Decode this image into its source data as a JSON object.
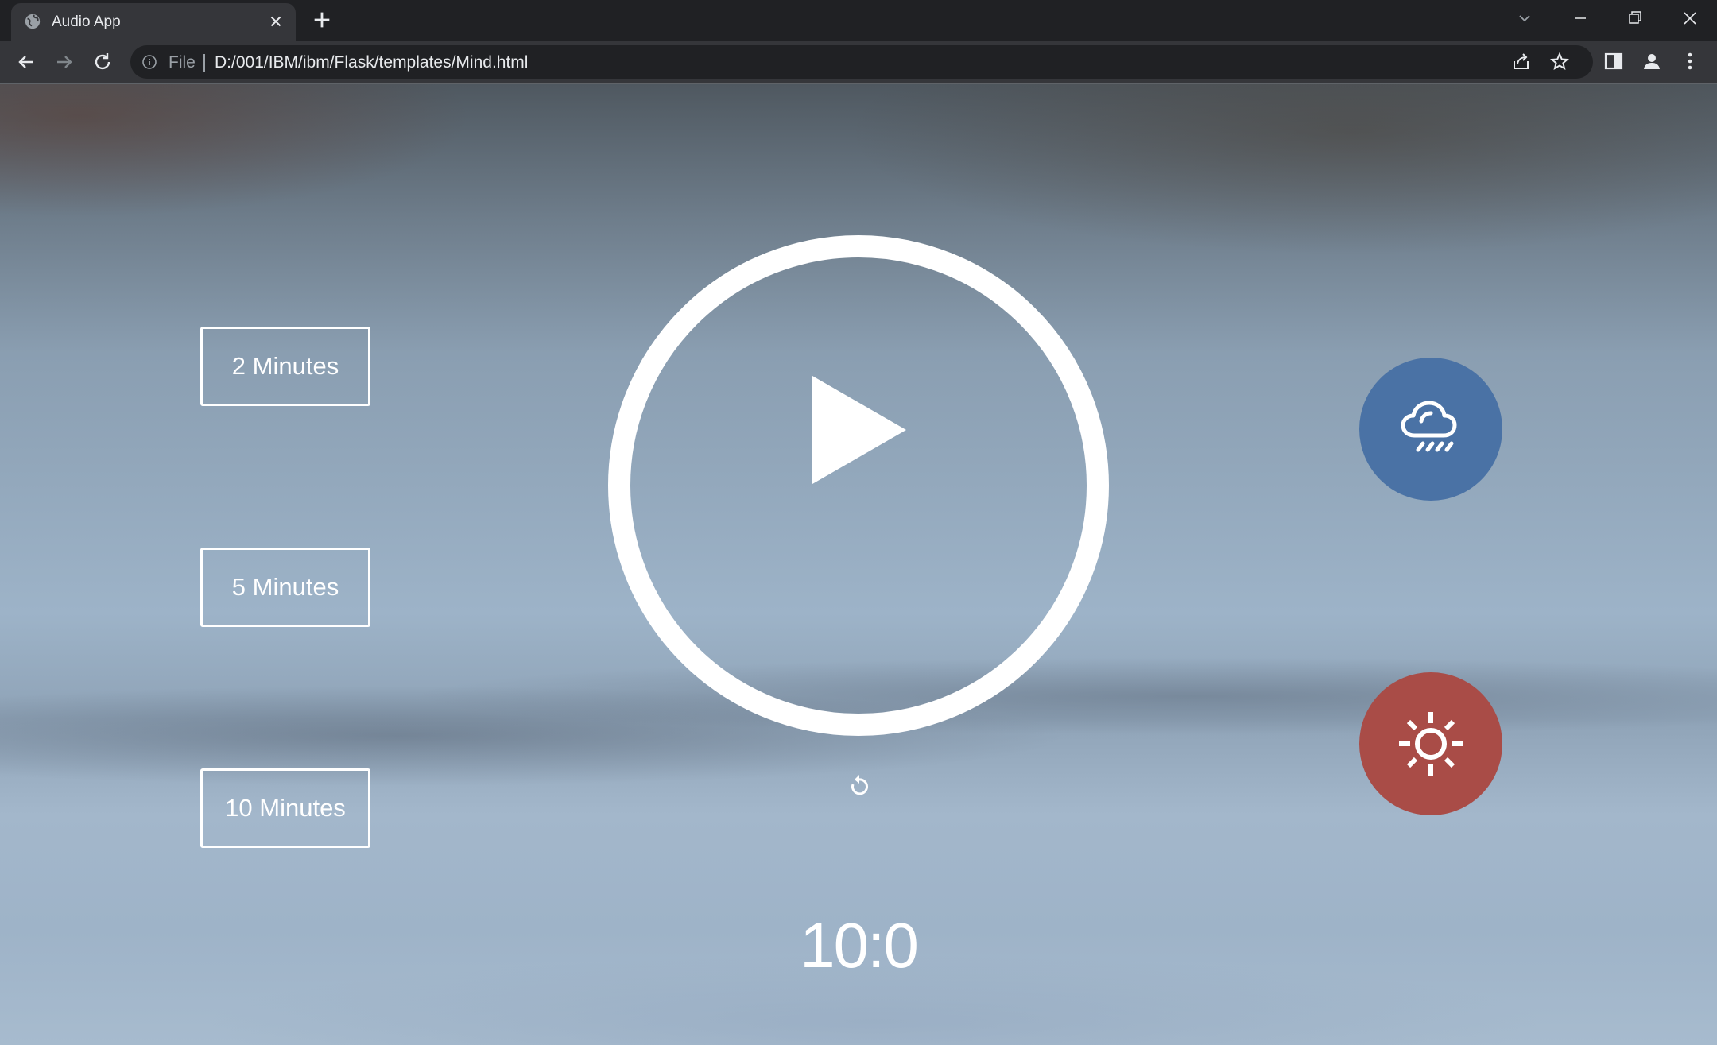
{
  "browser": {
    "tab_title": "Audio App",
    "url_scheme": "File",
    "url": "D:/001/IBM/ibm/Flask/templates/Mind.html"
  },
  "timer_options": [
    {
      "label": "2 Minutes"
    },
    {
      "label": "5 Minutes"
    },
    {
      "label": "10 Minutes"
    }
  ],
  "player": {
    "state": "paused",
    "play_icon": "play-icon",
    "replay_icon": "replay-icon"
  },
  "timer": {
    "display": "10:0"
  },
  "sounds": [
    {
      "name": "rain",
      "icon": "rain-cloud-icon",
      "color": "#4a72a5"
    },
    {
      "name": "summer",
      "icon": "sun-icon",
      "color": "#a94c47"
    }
  ]
}
